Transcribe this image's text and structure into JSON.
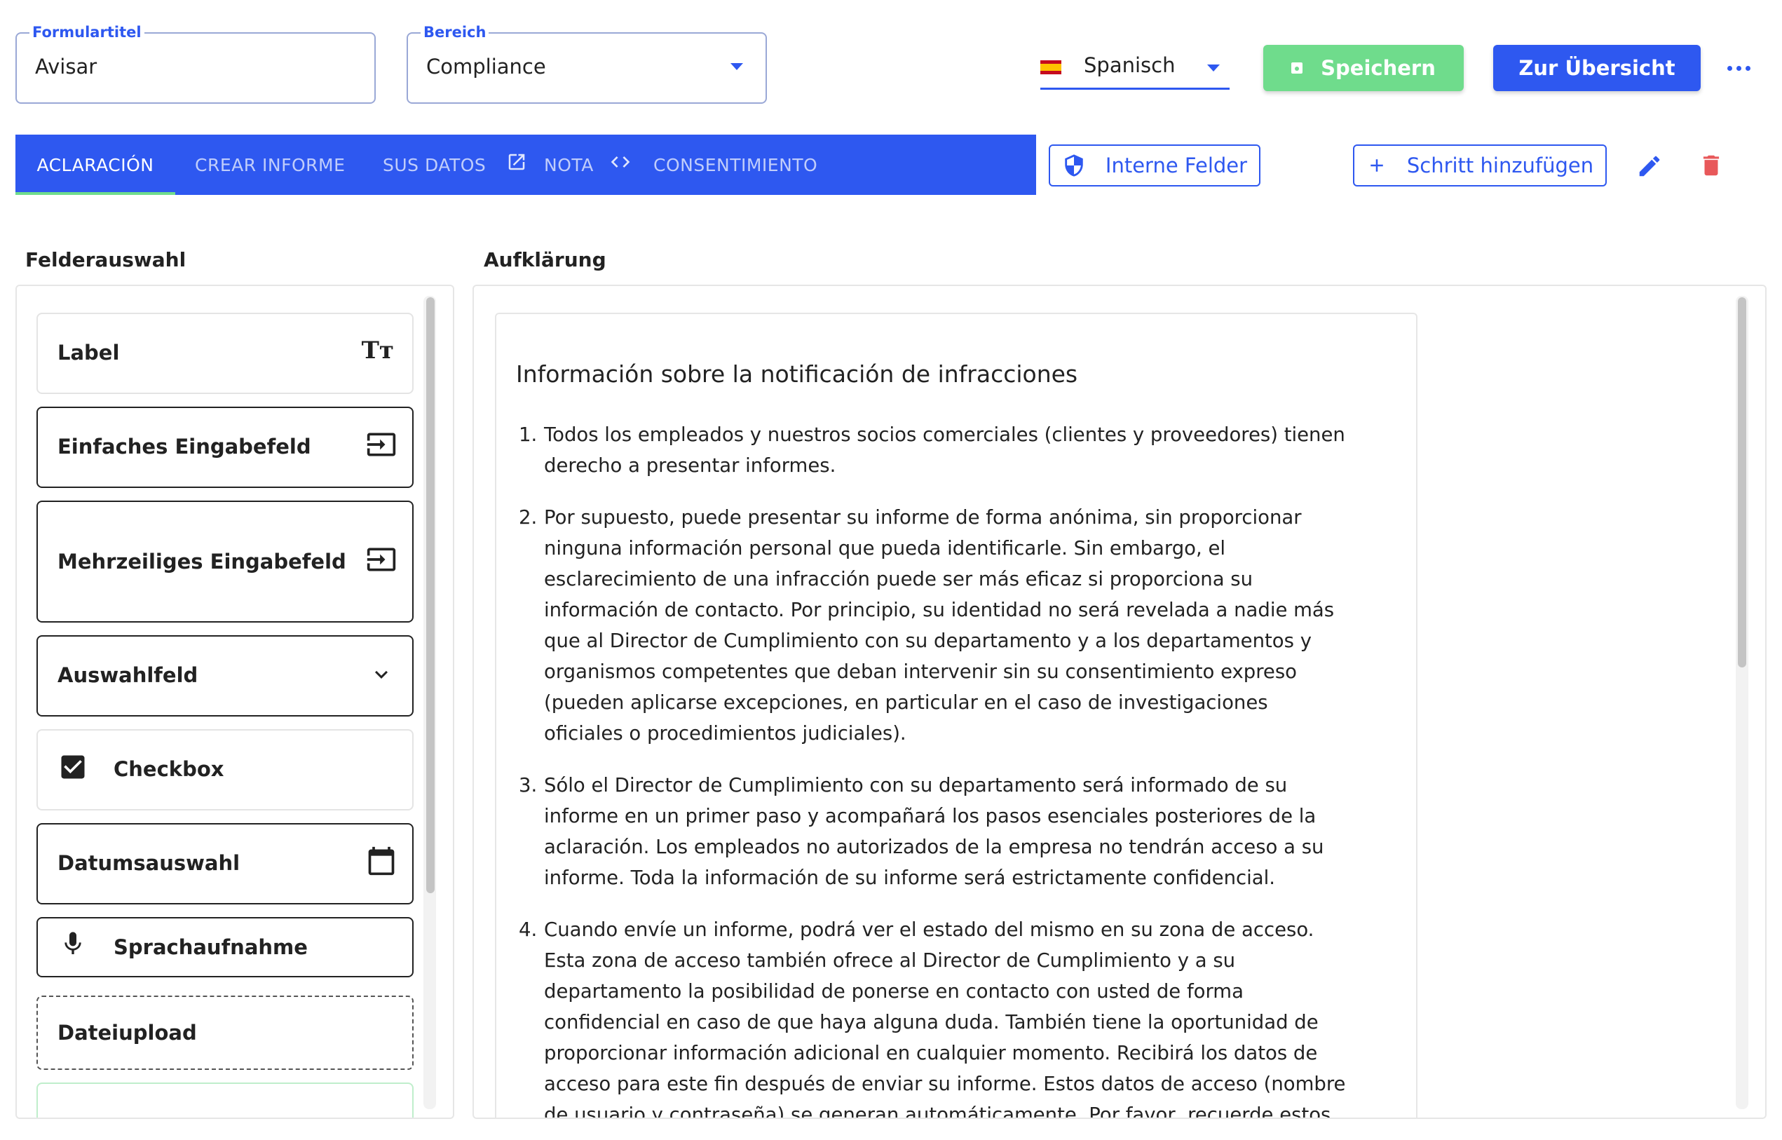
{
  "form_title_field": {
    "legend": "Formulartitel",
    "value": "Avisar"
  },
  "area_field": {
    "legend": "Bereich",
    "value": "Compliance"
  },
  "language": {
    "value": "Spanisch"
  },
  "buttons": {
    "save": "Speichern",
    "overview": "Zur Übersicht",
    "internal_fields": "Interne Felder",
    "add_step": "Schritt hinzufügen"
  },
  "tabs": [
    {
      "label": "ACLARACIÓN"
    },
    {
      "label": "CREAR INFORME"
    },
    {
      "label": "SUS DATOS"
    },
    {
      "label": "NOTA"
    },
    {
      "label": "CONSENTIMIENTO"
    }
  ],
  "left_panel": {
    "title": "Felderauswahl",
    "items": [
      {
        "label": "Label"
      },
      {
        "label": "Einfaches Eingabefeld"
      },
      {
        "label": "Mehrzeiliges Eingabefeld"
      },
      {
        "label": "Auswahlfeld"
      },
      {
        "label": "Checkbox"
      },
      {
        "label": "Datumsauswahl"
      },
      {
        "label": "Sprachaufnahme"
      },
      {
        "label": "Dateiupload"
      }
    ]
  },
  "right_panel": {
    "title": "Aufklärung",
    "content_title": "Información sobre la notificación de infracciones",
    "paragraphs": [
      {
        "num": "1.",
        "text": "Todos los empleados y nuestros socios comerciales (clientes y proveedores) tienen derecho a presentar informes."
      },
      {
        "num": "2.",
        "text": "Por supuesto, puede presentar su informe de forma anónima, sin proporcionar ninguna información personal que pueda identificarle. Sin embargo, el esclarecimiento de una infracción puede ser más eficaz si proporciona su información de contacto. Por principio, su identidad no será revelada a nadie más que al Director de Cumplimiento con su departamento y a los departamentos y organismos competentes que deban intervenir sin su consentimiento expreso (pueden aplicarse excepciones, en particular en el caso de investigaciones oficiales o procedimientos judiciales)."
      },
      {
        "num": "3.",
        "text": "Sólo el Director de Cumplimiento con su departamento será informado de su informe en un primer paso y acompañará los pasos esenciales posteriores de la aclaración. Los empleados no autorizados de la empresa no tendrán acceso a su informe. Toda la información de su informe será estrictamente confidencial."
      },
      {
        "num": "4.",
        "text": "Cuando envíe un informe, podrá ver el estado del mismo en su zona de acceso. Esta zona de acceso también ofrece al Director de Cumplimiento y a su departamento la posibilidad de ponerse en contacto con usted de forma confidencial en caso de que haya alguna duda. También tiene la oportunidad de proporcionar información adicional en cualquier momento. Recibirá los datos de acceso para este fin después de enviar su informe. Estos datos de acceso (nombre de usuario y contraseña) se generan automáticamente. Por favor, recuerde estos"
      }
    ]
  },
  "colors": {
    "primary": "#2e58f0",
    "success": "#6fdc8c",
    "danger": "#e8585a"
  }
}
